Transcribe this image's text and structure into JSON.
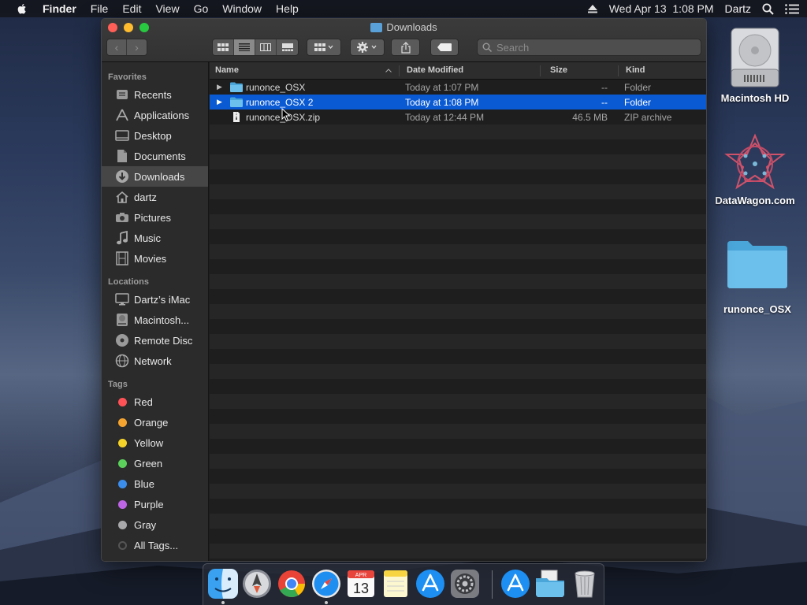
{
  "menubar": {
    "app": "Finder",
    "items": [
      "File",
      "Edit",
      "View",
      "Go",
      "Window",
      "Help"
    ],
    "datetime": "Wed Apr 13  1:08 PM",
    "user": "Dartz"
  },
  "window": {
    "title": "Downloads",
    "search_placeholder": "Search"
  },
  "sidebar": {
    "favorites_heading": "Favorites",
    "favorites": [
      "Recents",
      "Applications",
      "Desktop",
      "Documents",
      "Downloads",
      "dartz",
      "Pictures",
      "Music",
      "Movies"
    ],
    "locations_heading": "Locations",
    "locations": [
      "Dartz’s iMac",
      "Macintosh...",
      "Remote Disc",
      "Network"
    ],
    "tags_heading": "Tags",
    "tags": [
      {
        "label": "Red",
        "color": "#ff5257"
      },
      {
        "label": "Orange",
        "color": "#f5a430"
      },
      {
        "label": "Yellow",
        "color": "#f6d328"
      },
      {
        "label": "Green",
        "color": "#5bd05b"
      },
      {
        "label": "Blue",
        "color": "#3b8eec"
      },
      {
        "label": "Purple",
        "color": "#be65e5"
      },
      {
        "label": "Gray",
        "color": "#a9a9ab"
      },
      {
        "label": "All Tags...",
        "color": "#555555"
      }
    ]
  },
  "columns": {
    "name": "Name",
    "modified": "Date Modified",
    "size": "Size",
    "kind": "Kind"
  },
  "files": [
    {
      "name": "runonce_OSX",
      "modified": "Today at 1:07 PM",
      "size": "--",
      "kind": "Folder",
      "type": "folder",
      "selected": false
    },
    {
      "name": "runonce_OSX 2",
      "modified": "Today at 1:08 PM",
      "size": "--",
      "kind": "Folder",
      "type": "folder",
      "selected": true
    },
    {
      "name": "runonce_OSX.zip",
      "modified": "Today at 12:44 PM",
      "size": "46.5 MB",
      "kind": "ZIP archive",
      "type": "file",
      "selected": false
    }
  ],
  "desktop": [
    {
      "label": "Macintosh HD",
      "icon": "hard-drive-icon"
    },
    {
      "label": "DataWagon.com",
      "icon": "datawagon-logo-icon"
    },
    {
      "label": "runonce_OSX",
      "icon": "folder-icon"
    }
  ],
  "dock": {
    "calendar_month": "APR",
    "calendar_day": "13",
    "apps": [
      "finder-icon",
      "launchpad-icon",
      "chrome-icon",
      "safari-icon",
      "calendar-icon",
      "notes-icon",
      "app-store-icon",
      "system-preferences-icon",
      "applications-stack-icon",
      "downloads-stack-icon",
      "trash-icon"
    ]
  }
}
